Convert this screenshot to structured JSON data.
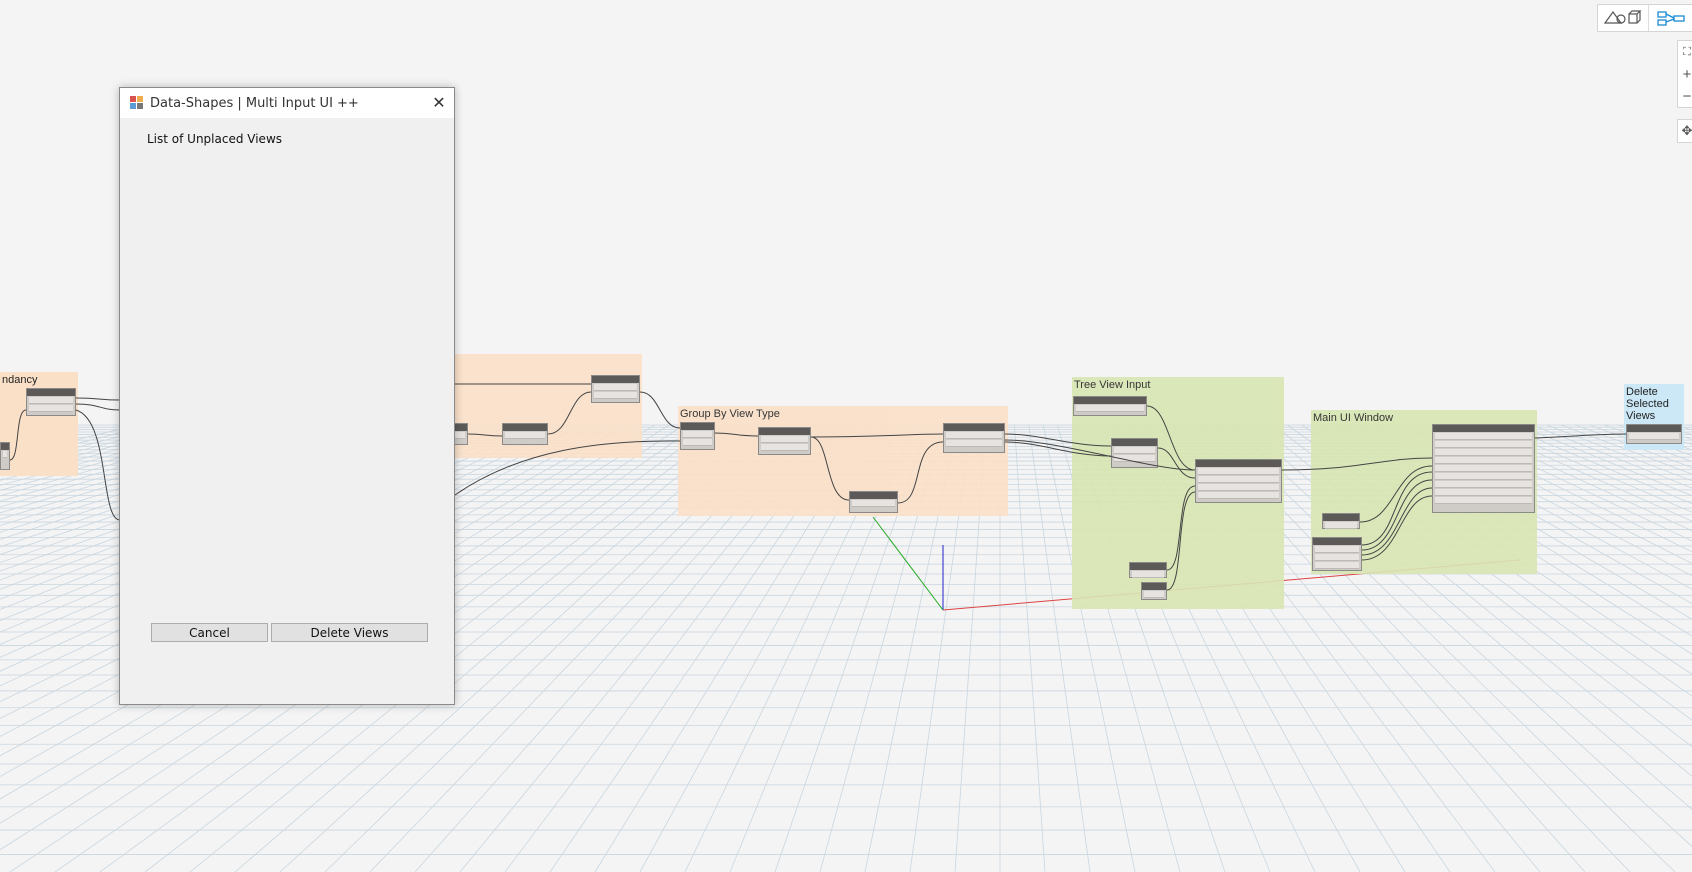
{
  "dialog": {
    "title": "Data-Shapes | Multi Input UI ++",
    "close_glyph": "✕",
    "label": "List of Unplaced Views",
    "cancel_label": "Cancel",
    "delete_label": "Delete Views"
  },
  "groups": {
    "redundancy_title": "ndancy",
    "group_by_view_type_title": "Group By View Type",
    "tree_view_input_title": "Tree View Input",
    "main_ui_window_title": "Main UI Window",
    "delete_selected_views_title": "Delete\nSelected\nViews"
  },
  "colors": {
    "orange_group": "#fbe0c8",
    "green_group": "#d8e6b2",
    "blue_group": "#cce8f7",
    "node_header": "#5b5a59",
    "node_body": "#cfcbc7",
    "grid_line": "#c9d6e0"
  },
  "toolbar": {
    "geometry_icon": "geometry-view-icon",
    "graph_icon": "graph-view-icon"
  },
  "nav": {
    "fit_icon": "fit-view-icon",
    "zoom_in": "+",
    "zoom_out": "−",
    "pan_icon": "pan-icon"
  }
}
